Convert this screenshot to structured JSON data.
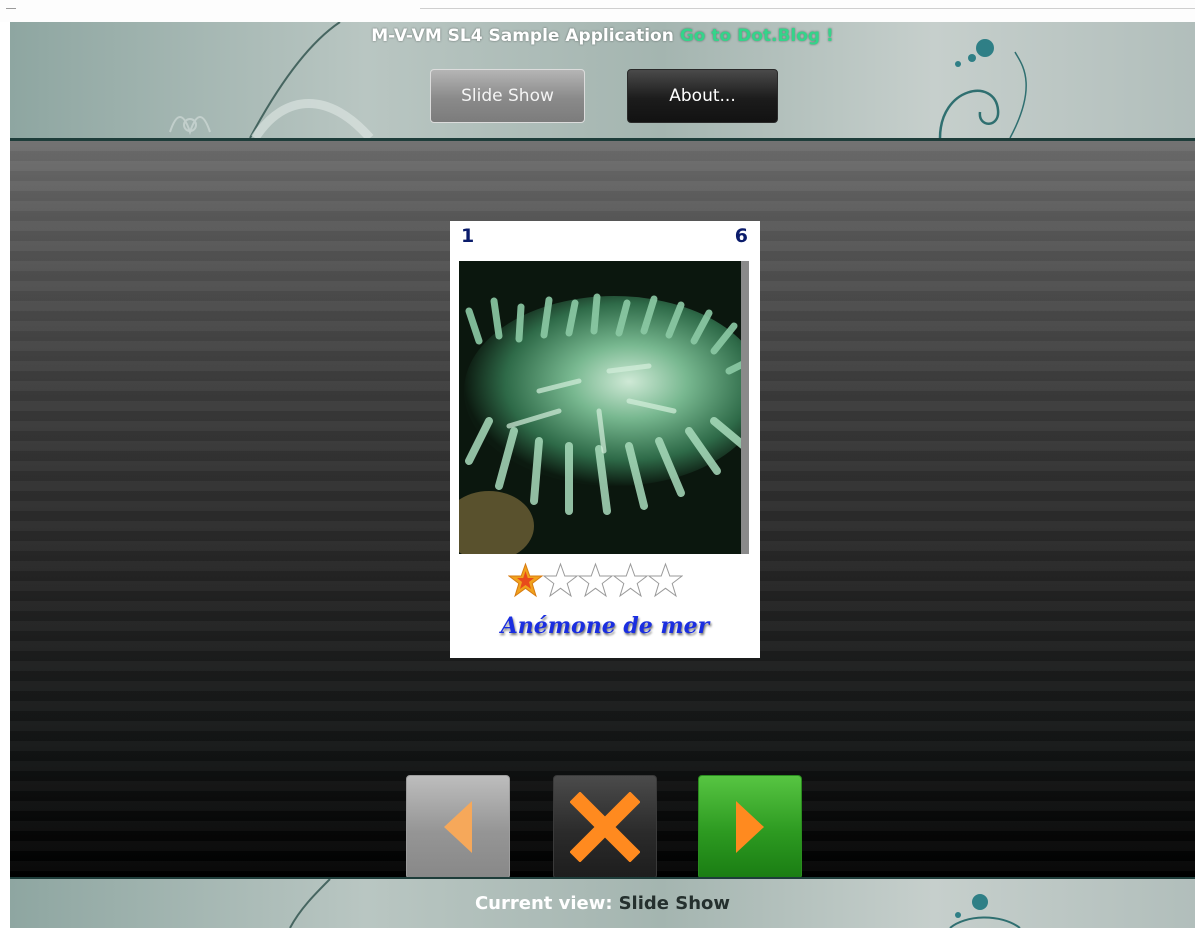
{
  "header": {
    "title": "M-V-VM SL4 Sample Application",
    "blog_link": "Go to Dot.Blog !",
    "nav": {
      "slideshow_label": "Slide Show",
      "about_label": "About..."
    }
  },
  "slide": {
    "current_index": "1",
    "total": "6",
    "caption": "Anémone de mer",
    "rating": 1,
    "max_rating": 5
  },
  "controls": {
    "prev_icon": "left-arrow-icon",
    "close_icon": "close-x-icon",
    "next_icon": "right-arrow-icon"
  },
  "footer": {
    "status_label": "Current view:",
    "status_value": "Slide Show"
  },
  "colors": {
    "accent_link": "#34d48a",
    "next_green": "#2d9a21",
    "arrow_orange": "#ff8a1f",
    "header_border": "#1e3d3a"
  }
}
